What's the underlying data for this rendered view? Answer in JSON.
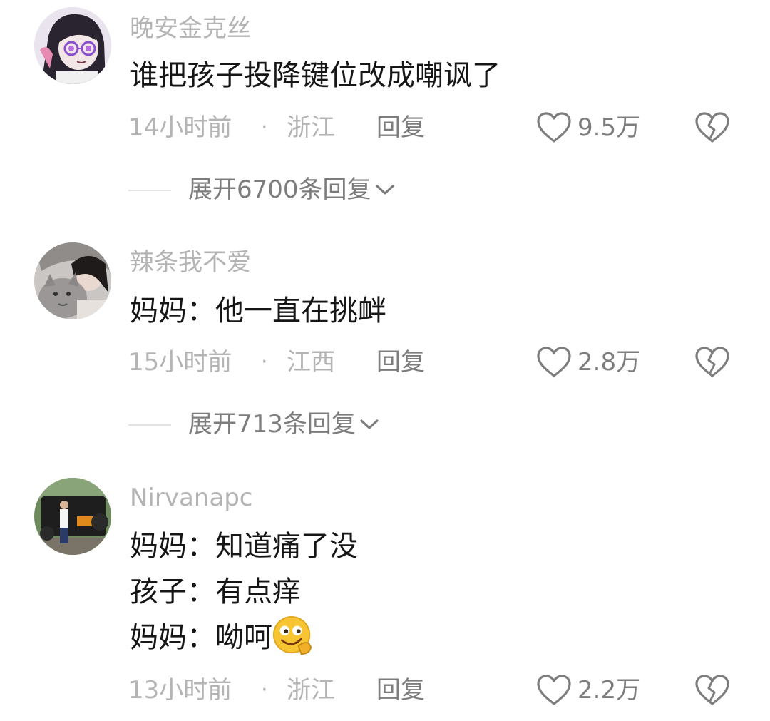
{
  "comments": [
    {
      "username": "晚安金克丝",
      "lines": [
        "谁把孩子投降键位改成嘲讽了"
      ],
      "time": "14小时前",
      "dot": "·",
      "location": "浙江",
      "reply_label": "回复",
      "like_count": "9.5万",
      "expand_label": "展开6700条回复",
      "avatar_icon": "anime-glasses-avatar"
    },
    {
      "username": "辣条我不爱",
      "lines": [
        "妈妈：他一直在挑衅"
      ],
      "time": "15小时前",
      "dot": "·",
      "location": "江西",
      "reply_label": "回复",
      "like_count": "2.8万",
      "expand_label": "展开713条回复",
      "avatar_icon": "girl-with-cat-avatar"
    },
    {
      "username": "Nirvanapc",
      "lines": [
        "妈妈：知道痛了没",
        "孩子：有点痒",
        "妈妈：呦呵"
      ],
      "time": "13小时前",
      "dot": "·",
      "location": "浙江",
      "reply_label": "回复",
      "like_count": "2.2万",
      "avatar_icon": "man-with-jeep-avatar",
      "inline_emoji": "smirk-emoji"
    }
  ],
  "colors": {
    "text": "#161616",
    "muted": "#b4b4b4",
    "action": "#7d7d7d",
    "divider": "#e2e2e2"
  }
}
